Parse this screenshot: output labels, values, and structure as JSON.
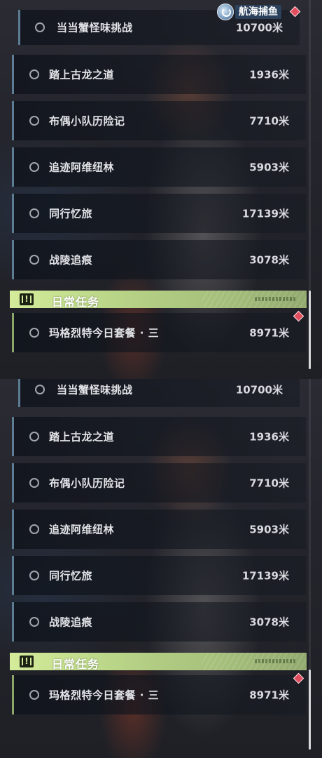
{
  "hud": {
    "badge_label": "航海捕鱼",
    "emblem_icon": "compass-fish-emblem-icon",
    "alert_icon": "red-diamond-alert-icon"
  },
  "quests": [
    {
      "name": "当当蟹怪味挑战",
      "distance": "10700米"
    },
    {
      "name": "踏上古龙之道",
      "distance": "1936米"
    },
    {
      "name": "布偶小队历险记",
      "distance": "7710米"
    },
    {
      "name": "追迹阿维纽林",
      "distance": "5903米"
    },
    {
      "name": "同行忆旅",
      "distance": "17139米"
    },
    {
      "name": "战陵追痕",
      "distance": "3078米"
    }
  ],
  "daily_section": {
    "title": "日常任务",
    "icon": "exclamation-quest-icon",
    "quests": [
      {
        "name": "玛格烈特今日套餐 · 三",
        "distance": "8971米"
      }
    ]
  },
  "colors": {
    "accent_blue": "#5c7d93",
    "accent_green": "#b9d587",
    "alert_red": "#e24d5e"
  }
}
